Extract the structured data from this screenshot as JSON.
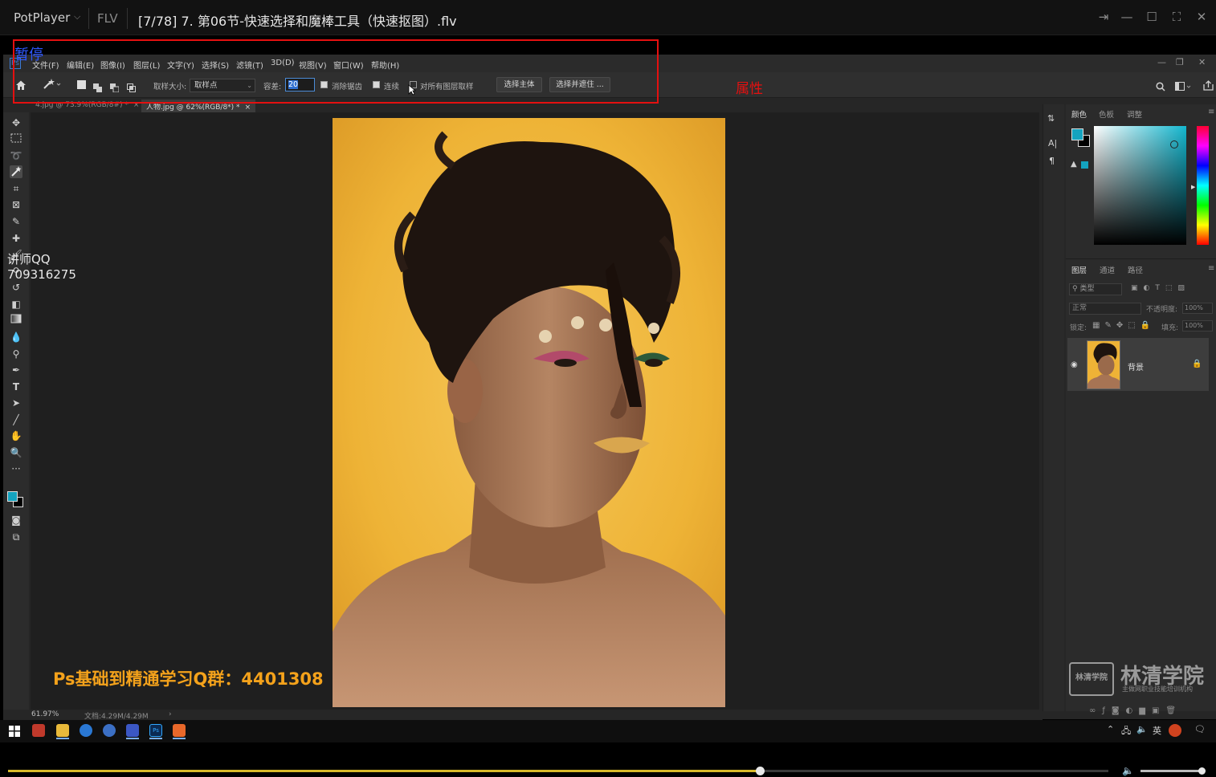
{
  "player": {
    "app_name": "PotPlayer",
    "format": "FLV",
    "file_title": "[7/78] 7. 第06节-快速选择和魔棒工具（快速抠图）.flv",
    "window_controls": [
      "pin-icon",
      "minimize-icon",
      "maximize-icon",
      "fullscreen-icon",
      "close-icon"
    ],
    "seek_progress": 0.683,
    "volume_level": 0.95
  },
  "overlays": {
    "pause_label": "暂停",
    "attribute_label": "属性",
    "teacher_qq_line1": "讲师QQ",
    "teacher_qq_line2": "709316275",
    "group_ad": "Ps基础到精通学习Q群：4401308",
    "watermark_badge": "林清学院",
    "watermark_title": "林清学院",
    "watermark_subtitle": "主做网职业技能培训机构"
  },
  "photoshop": {
    "logo": "Ps",
    "menu": [
      "文件(F)",
      "编辑(E)",
      "图像(I)",
      "图层(L)",
      "文字(Y)",
      "选择(S)",
      "滤镜(T)",
      "3D(D)",
      "视图(V)",
      "窗口(W)",
      "帮助(H)"
    ],
    "options": {
      "sample_size_label": "取样大小:",
      "sample_size_value": "取样点",
      "tolerance_label": "容差:",
      "tolerance_value": "20",
      "anti_alias_label": "消除锯齿",
      "anti_alias_checked": true,
      "contiguous_label": "连续",
      "contiguous_checked": true,
      "sample_all_label": "对所有图层取样",
      "sample_all_checked": false,
      "select_subject_label": "选择主体",
      "select_mask_label": "选择并遮住 ..."
    },
    "tabs": [
      {
        "label": "4.jpg @ 73.9%(RGB/8#) *",
        "active": false
      },
      {
        "label": "人物.jpg @ 62%(RGB/8*) *",
        "active": true
      }
    ],
    "color_panel": {
      "tabs": [
        "颜色",
        "色板",
        "调整"
      ],
      "foreground": "#14a3bf",
      "background": "#000000"
    },
    "layers_panel": {
      "tabs": [
        "图层",
        "通道",
        "路径"
      ],
      "filter_label": "类型",
      "blend_mode": "正常",
      "opacity_label": "不透明度:",
      "opacity_value": "100%",
      "lock_label": "锁定:",
      "fill_label": "填充:",
      "fill_value": "100%",
      "layer_name": "背景"
    },
    "status": {
      "zoom": "61.97%",
      "doc_size": "文档:4.29M/4.29M"
    }
  },
  "taskbar": {
    "ime": "英"
  }
}
